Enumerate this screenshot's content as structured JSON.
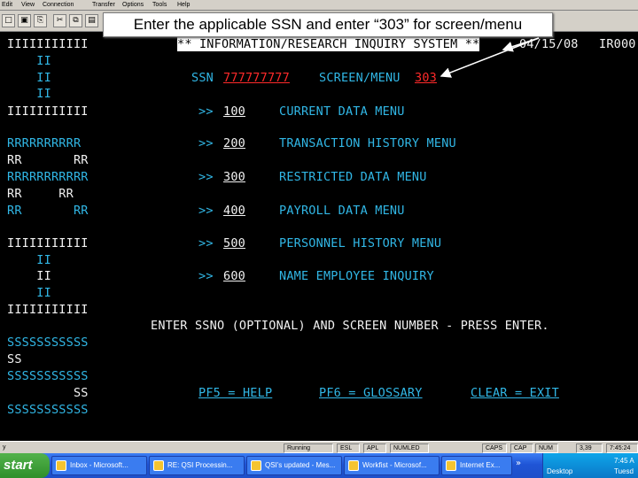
{
  "window": {
    "menu": [
      "Edit",
      "View",
      "Connection",
      "Transfer",
      "Options",
      "Tools",
      "Help"
    ]
  },
  "callout": {
    "text": "Enter the applicable SSN and enter “303” for screen/menu"
  },
  "terminal": {
    "logo_lines": [
      "IIIIIIIIIII",
      "    II",
      "    II",
      "    II",
      "IIIIIIIIIII",
      "RRRRRRRRRR",
      "RR       RR",
      "RRRRRRRRRRR",
      "RR     RR",
      "RR       RR",
      "IIIIIIIIIII",
      "    II",
      "    II",
      "    II",
      "IIIIIIIIIII",
      "SSSSSSSSSSS",
      "SS",
      "SSSSSSSSSSS",
      "         SS",
      "SSSSSSSSSSS"
    ],
    "header_title": "** INFORMATION/RESEARCH INQUIRY SYSTEM **",
    "date": "04/15/08",
    "screen_id": "IR000",
    "ssn_label": "SSN",
    "ssn_value": "777777777",
    "screen_menu_label": "SCREEN/MENU",
    "screen_menu_value": "303",
    "menu_prompt": ">>",
    "menu_items": [
      {
        "code": "100",
        "label": "CURRENT DATA MENU"
      },
      {
        "code": "200",
        "label": "TRANSACTION HISTORY MENU"
      },
      {
        "code": "300",
        "label": "RESTRICTED DATA MENU"
      },
      {
        "code": "400",
        "label": "PAYROLL DATA MENU"
      },
      {
        "code": "500",
        "label": "PERSONNEL HISTORY MENU"
      },
      {
        "code": "600",
        "label": "NAME EMPLOYEE INQUIRY"
      }
    ],
    "instruction": "ENTER SSNO (OPTIONAL) AND SCREEN NUMBER - PRESS ENTER.",
    "function_keys": [
      {
        "label": "PF5 = HELP"
      },
      {
        "label": "PF6 = GLOSSARY"
      },
      {
        "label": "CLEAR = EXIT"
      }
    ]
  },
  "statusbar": {
    "left": "y",
    "fields": [
      "Running",
      "ESL",
      "APL",
      "NUMLED",
      "CAPS",
      "CAP",
      "NUM",
      "3,39"
    ],
    "time": "7:45:24"
  },
  "taskbar": {
    "start": "start",
    "tasks": [
      "Inbox - Microsoft...",
      "RE: QSI Processin...",
      "QSI's updated - Mes...",
      "Workfist - Microsof...",
      "Internet Ex..."
    ],
    "tray_time": "7:45 A",
    "tray_day": "Tuesd",
    "tray_label": "Desktop"
  },
  "colors": {
    "terminal_bg": "#000000",
    "text_white": "#f2f2f2",
    "text_cyan": "#31b7e6",
    "text_red": "#ff2a2a"
  }
}
